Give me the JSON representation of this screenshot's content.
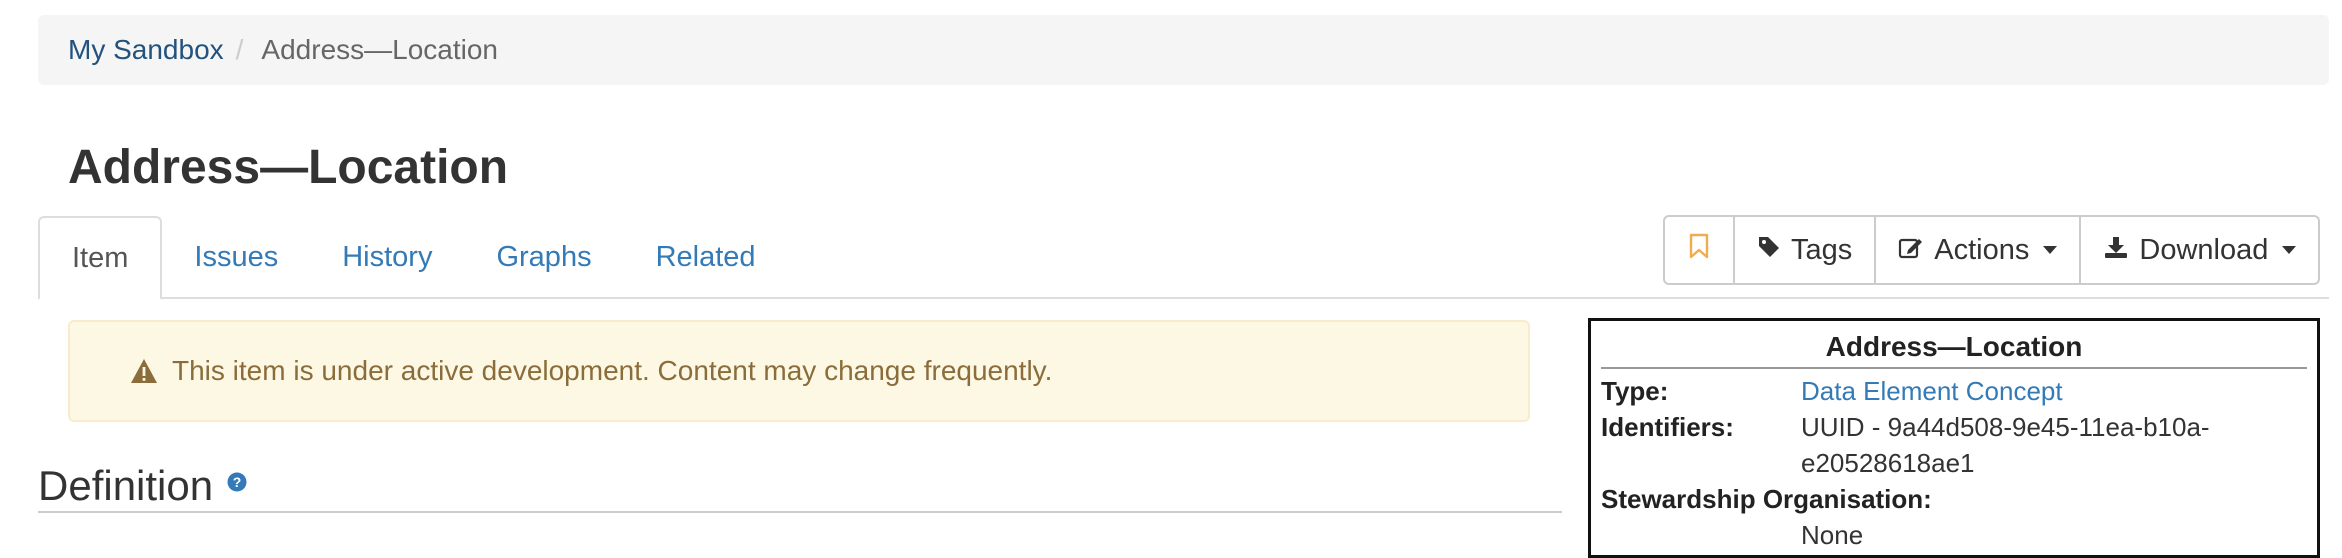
{
  "breadcrumb": {
    "parent": "My Sandbox",
    "separator": "/",
    "current": "Address—Location"
  },
  "page": {
    "title": "Address—Location"
  },
  "tabs": [
    {
      "label": "Item",
      "active": true
    },
    {
      "label": "Issues"
    },
    {
      "label": "History"
    },
    {
      "label": "Graphs"
    },
    {
      "label": "Related"
    }
  ],
  "toolbar": {
    "tags_label": "Tags",
    "actions_label": "Actions",
    "download_label": "Download"
  },
  "alert": {
    "message": "This item is under active development. Content may change frequently."
  },
  "definition": {
    "heading": "Definition"
  },
  "infobox": {
    "title": "Address—Location",
    "type_label": "Type:",
    "type_value": "Data Element Concept",
    "identifiers_label": "Identifiers:",
    "identifiers_value": "UUID - 9a44d508-9e45-11ea-b10a-e20528618ae1",
    "stewardship_label": "Stewardship Organisation:",
    "stewardship_value": "None"
  },
  "colors": {
    "link": "#337ab7",
    "alert_bg": "#fcf8e3",
    "alert_text": "#8a6d3b",
    "bookmark": "#f0ad4e"
  }
}
